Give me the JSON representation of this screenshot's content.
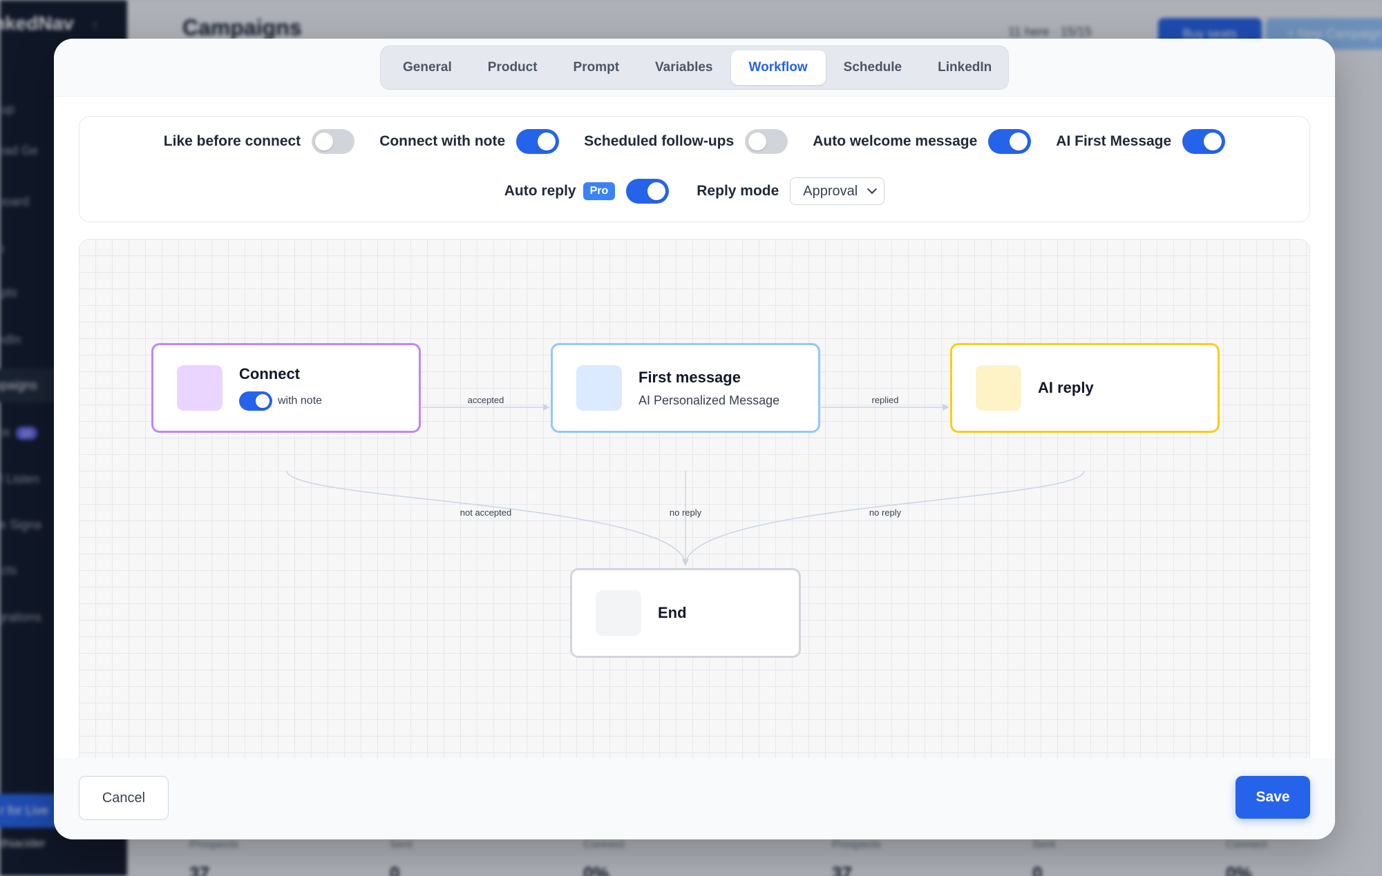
{
  "background": {
    "logo": "nkedNav",
    "page_title": "Campaigns",
    "seats": "11 here · 15/15",
    "buy_seats": "Buy seats",
    "new_campaign": "+ New Campaign",
    "nav": [
      {
        "label": "etup"
      },
      {
        "label": "Lead Ge"
      },
      {
        "label": "hboard"
      },
      {
        "label": "ap"
      },
      {
        "label": "mpts"
      },
      {
        "label": "kedIn"
      },
      {
        "label": "mpaigns"
      },
      {
        "label": "box",
        "badge": "10"
      },
      {
        "label": "ial Listen"
      },
      {
        "label": "ive Signa"
      },
      {
        "label": "tacts"
      },
      {
        "label": "egrations"
      }
    ],
    "cta": "r for Live",
    "user": "ethiacider",
    "stats_labels": [
      "Prospects",
      "Sent",
      "Connect",
      "Prospects",
      "Sent",
      "Connect"
    ],
    "stats_values": [
      "37",
      "0",
      "0%",
      "37",
      "0",
      "0%"
    ]
  },
  "tabs": [
    {
      "label": "General",
      "active": false
    },
    {
      "label": "Product",
      "active": false
    },
    {
      "label": "Prompt",
      "active": false
    },
    {
      "label": "Variables",
      "active": false
    },
    {
      "label": "Workflow",
      "active": true
    },
    {
      "label": "Schedule",
      "active": false
    },
    {
      "label": "LinkedIn",
      "active": false
    }
  ],
  "settings": {
    "like_before_connect": {
      "label": "Like before connect",
      "on": false
    },
    "connect_with_note": {
      "label": "Connect with note",
      "on": true
    },
    "scheduled_followups": {
      "label": "Scheduled follow-ups",
      "on": false
    },
    "auto_welcome": {
      "label": "Auto welcome message",
      "on": true
    },
    "ai_first_message": {
      "label": "AI First Message",
      "on": true
    },
    "auto_reply": {
      "label": "Auto reply",
      "badge": "Pro",
      "on": true
    },
    "reply_mode": {
      "label": "Reply mode",
      "value": "Approval"
    }
  },
  "workflow": {
    "nodes": {
      "connect": {
        "title": "Connect",
        "sub": "with note",
        "toggle_on": true
      },
      "first_message": {
        "title": "First message",
        "sub": "AI Personalized Message"
      },
      "ai_reply": {
        "title": "AI reply"
      },
      "end": {
        "title": "End"
      }
    },
    "edges": {
      "accepted": "accepted",
      "replied": "replied",
      "not_accepted": "not accepted",
      "no_reply_first": "no reply",
      "no_reply_ai": "no reply"
    },
    "colors": {
      "connect_border": "#c084fc",
      "first_border": "#93c5fd",
      "ai_border": "#facc15",
      "end_border": "#d1d5db",
      "edge": "#cbd5e1"
    }
  },
  "footer": {
    "cancel": "Cancel",
    "save": "Save"
  }
}
